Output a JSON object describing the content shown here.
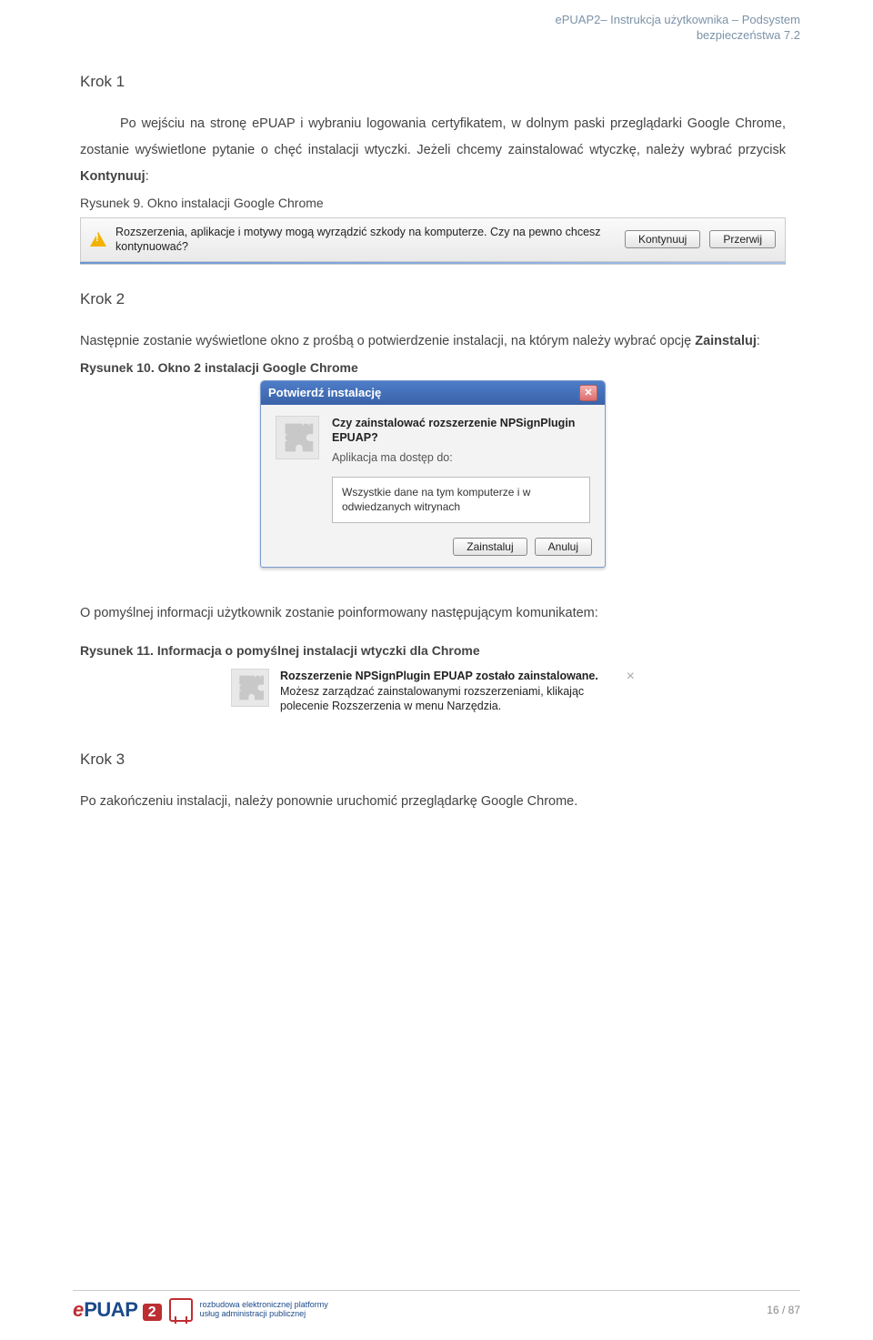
{
  "header": {
    "line1": "ePUAP2– Instrukcja użytkownika – Podsystem",
    "line2": "bezpieczeństwa 7.2"
  },
  "body": {
    "step1_title": "Krok 1",
    "step1_para1": "Po wejściu na stronę ePUAP i wybraniu logowania certyfikatem, w dolnym paski przeglądarki Google Chrome, zostanie wyświetlone pytanie o chęć instalacji wtyczki. Jeżeli chcemy zainstalować wtyczkę, należy wybrać przycisk ",
    "step1_bold": "Kontynuuj",
    "step1_after": ":",
    "caption1": "Rysunek 9. Okno instalacji Google Chrome",
    "bar_text": "Rozszerzenia, aplikacje i motywy mogą wyrządzić szkody na komputerze. Czy na pewno chcesz kontynuować?",
    "bar_continue": "Kontynuuj",
    "bar_cancel": "Przerwij",
    "step2_title": "Krok 2",
    "step2_para": "Następnie zostanie wyświetlone okno z prośbą o potwierdzenie instalacji, na którym należy wybrać opcję ",
    "step2_bold": "Zainstaluj",
    "step2_after": ":",
    "caption2": "Rysunek 10. Okno 2 instalacji Google Chrome",
    "dlg_title": "Potwierdź instalację",
    "dlg_main": "Czy zainstalować rozszerzenie NPSignPlugin EPUAP?",
    "dlg_sub": "Aplikacja ma dostęp do:",
    "dlg_perm": "Wszystkie dane na tym komputerze i w odwiedzanych witrynach",
    "dlg_install": "Zainstaluj",
    "dlg_cancel": "Anuluj",
    "step2_outro": "O pomyślnej informacji użytkownik zostanie poinformowany następującym komunikatem:",
    "caption3": "Rysunek 11. Informacja o pomyślnej instalacji wtyczki dla Chrome",
    "notif_strong": "Rozszerzenie NPSignPlugin EPUAP zostało zainstalowane.",
    "notif_sub": "Możesz zarządzać zainstalowanymi rozszerzeniami, klikając polecenie Rozszerzenia w menu Narzędzia.",
    "step3_title": "Krok 3",
    "step3_para": "Po zakończeniu instalacji, należy ponownie uruchomić przeglądarkę Google Chrome."
  },
  "footer": {
    "logo_e": "e",
    "logo_puap": "PUAP",
    "logo_2": "2",
    "logo_sub1": "rozbudowa elektronicznej platformy",
    "logo_sub2": "usług administracji publicznej",
    "page": "16 / 87"
  }
}
